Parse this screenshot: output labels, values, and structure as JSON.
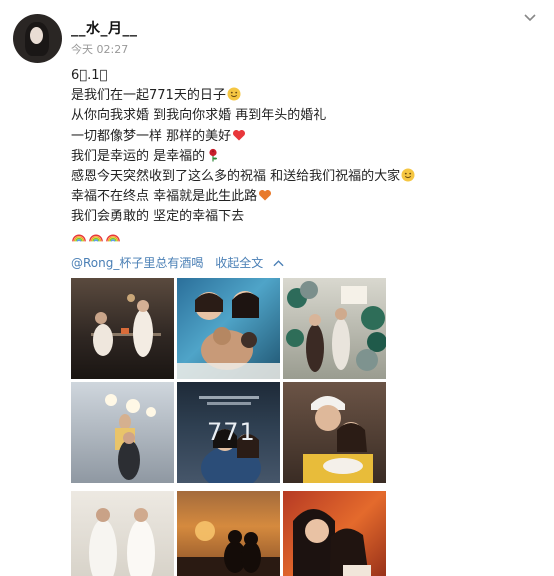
{
  "header": {
    "username": "__水_月__",
    "timestamp": "今天 02:27"
  },
  "post": {
    "lines": [
      "6⃣.1⃣",
      "是我们在一起771天的日子",
      "从你向我求婚 到我向你求婚 再到年头的婚礼",
      "一切都像梦一样 那样的美好",
      "我们是幸运的 是幸福的",
      "感恩今天突然收到了这么多的祝福 和送给我们祝福的大家",
      "幸福不在终点 幸福就是此生此路",
      "我们会勇敢的 坚定的幸福下去"
    ],
    "emojis": {
      "line1": "smile-emoji",
      "line3": "red-heart-emoji",
      "line4": "rose-emoji",
      "line5": "smile-emoji",
      "line6": "orange-heart-emoji",
      "last_row": [
        "rainbow-emoji",
        "rainbow-emoji",
        "rainbow-emoji"
      ]
    }
  },
  "mention": {
    "handle": "@Rong_杯子里总有酒喝",
    "collapse_label": "收起全文"
  },
  "photos": {
    "overlay_number": "771",
    "tiles": [
      "photo-couple-night-balcony",
      "photo-couple-with-cat",
      "photo-balloons-party",
      "photo-stage-lights",
      "photo-771-anniversary",
      "photo-couple-selfie-hat",
      "photo-wedding-dresses",
      "photo-sunset-silhouette",
      "photo-kiss-orange"
    ]
  },
  "colors": {
    "link": "#4a7fb5",
    "timestamp": "#999999",
    "text": "#222222"
  }
}
